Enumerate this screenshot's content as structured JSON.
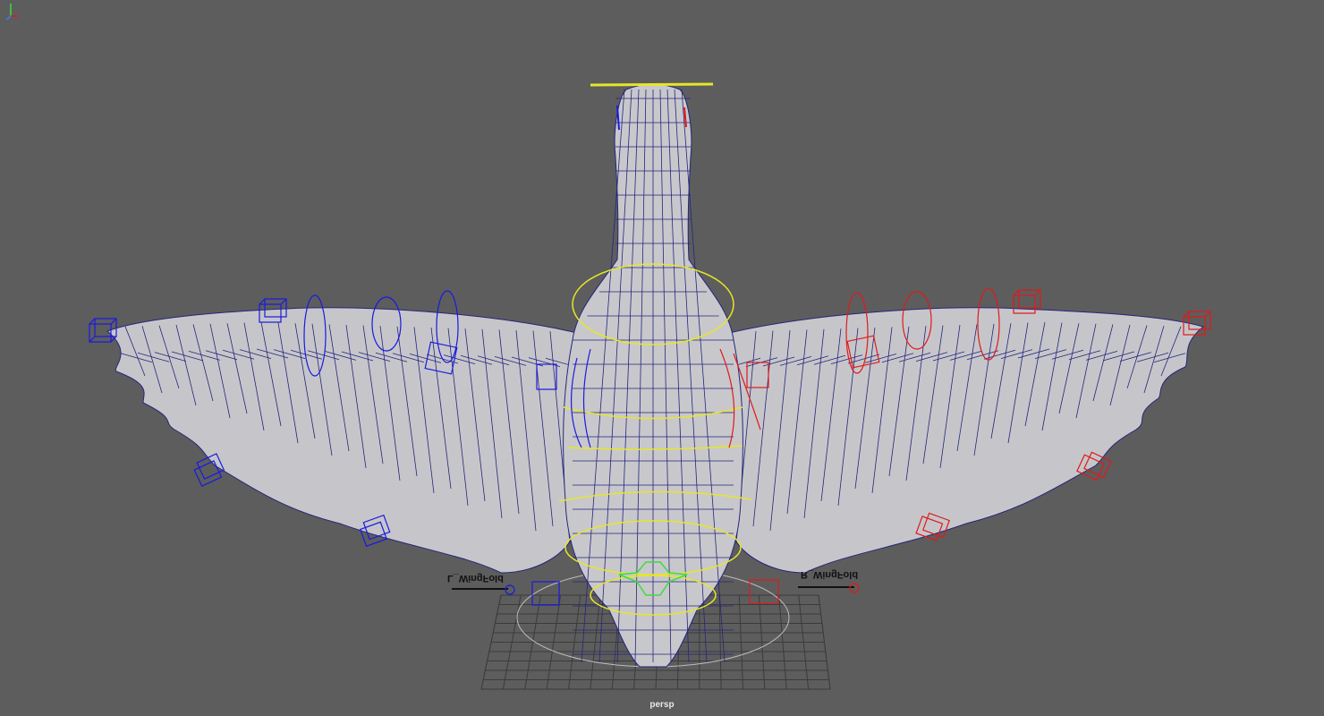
{
  "viewport": {
    "camera_label": "persp",
    "background_color": "#5d5d5d",
    "mesh_color": "#c5c5c9",
    "wire_color": "#20207a",
    "left_ctl_color": "#1a1ae0",
    "right_ctl_color": "#e01a1a",
    "center_ctl_color": "#e6e62a",
    "root_ctl_color": "#3ddc3d",
    "grid_color": "#3a3a3a"
  },
  "annotations": {
    "left_wingfold": "L_WingFold",
    "right_wingfold": "R_WingFold"
  },
  "icons": {
    "axis": "axis-gizmo-icon"
  }
}
